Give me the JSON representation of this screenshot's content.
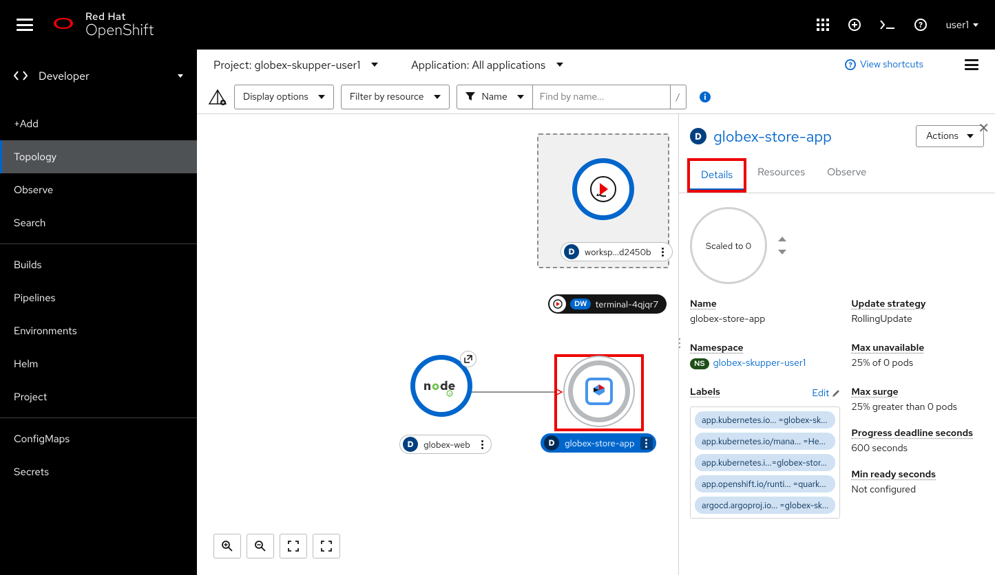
{
  "masthead": {
    "brand": "Red Hat",
    "product": "OpenShift",
    "user": "user1"
  },
  "sidebar": {
    "perspective": "Developer",
    "items": [
      "+Add",
      "Topology",
      "Observe",
      "Search",
      "Builds",
      "Pipelines",
      "Environments",
      "Helm",
      "Project",
      "ConfigMaps",
      "Secrets"
    ],
    "active_index": 1
  },
  "topbar": {
    "project_prefix": "Project: ",
    "project": "globex-skupper-user1",
    "application_prefix": "Application: ",
    "application": "All applications",
    "view_shortcuts": "View shortcuts",
    "display_options": "Display options",
    "filter_by_resource": "Filter by resource",
    "name_filter": "Name",
    "find_placeholder": "Find by name...",
    "slash": "/"
  },
  "topology": {
    "workspace_label": "worksp...d2450b",
    "terminal_label": "terminal-4qjqr7",
    "terminal_badge": "DW",
    "globex_web": "globex-web",
    "globex_store": "globex-store-app"
  },
  "panel": {
    "title": "globex-store-app",
    "actions": "Actions",
    "tabs": [
      "Details",
      "Resources",
      "Observe"
    ],
    "scaled": "Scaled to 0",
    "details": {
      "name_k": "Name",
      "name_v": "globex-store-app",
      "namespace_k": "Namespace",
      "namespace_badge": "NS",
      "namespace_v": "globex-skupper-user1",
      "update_k": "Update strategy",
      "update_v": "RollingUpdate",
      "maxun_k": "Max unavailable",
      "maxun_v": "25% of 0 pods",
      "labels_k": "Labels",
      "edit": "Edit",
      "labels": [
        "app.kubernetes.io... =globex-sk...",
        "app.kubernetes.io/mana... =He...",
        "app.kubernetes.i...=globex-stor...",
        "app.openshift.io/runti... =quark...",
        "argocd.argoproj.io... =globex-sk..."
      ],
      "maxsurge_k": "Max surge",
      "maxsurge_v": "25% greater than 0 pods",
      "progress_k": "Progress deadline seconds",
      "progress_v": "600 seconds",
      "minready_k": "Min ready seconds",
      "minready_v": "Not configured"
    }
  }
}
